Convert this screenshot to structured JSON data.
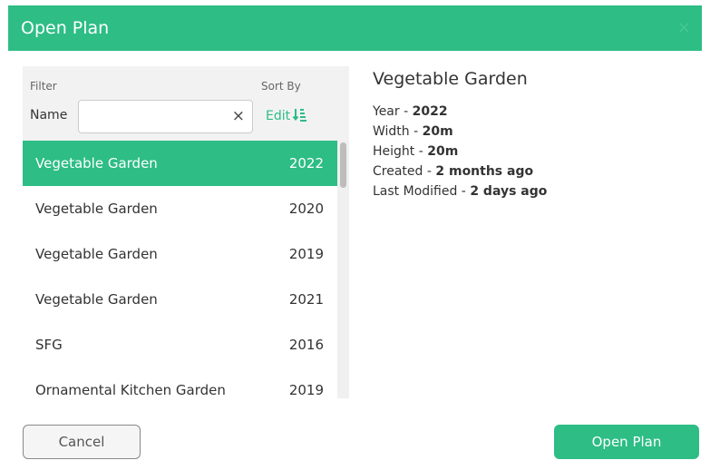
{
  "dialog": {
    "title": "Open Plan",
    "close_label": "×"
  },
  "filter": {
    "filter_label": "Filter",
    "name_label": "Name",
    "name_value": "",
    "clear_label": "×",
    "sort_by_label": "Sort By",
    "edit_label": "Edit"
  },
  "list": {
    "items": [
      {
        "name": "Vegetable Garden",
        "year": "2022",
        "selected": true
      },
      {
        "name": "Vegetable Garden",
        "year": "2020",
        "selected": false
      },
      {
        "name": "Vegetable Garden",
        "year": "2019",
        "selected": false
      },
      {
        "name": "Vegetable Garden",
        "year": "2021",
        "selected": false
      },
      {
        "name": "SFG",
        "year": "2016",
        "selected": false
      },
      {
        "name": "Ornamental Kitchen Garden",
        "year": "2019",
        "selected": false
      }
    ]
  },
  "details": {
    "title": "Vegetable Garden",
    "year_label": "Year - ",
    "year_value": "2022",
    "width_label": "Width - ",
    "width_value": "20m",
    "height_label": "Height - ",
    "height_value": "20m",
    "created_label": "Created - ",
    "created_value": "2 months ago",
    "modified_label": "Last Modified - ",
    "modified_value": "2 days ago"
  },
  "footer": {
    "cancel_label": "Cancel",
    "open_label": "Open Plan"
  },
  "colors": {
    "accent": "#2dbd85"
  },
  "icons": {
    "close": "close-icon",
    "clear": "clear-icon",
    "sort": "sort-icon"
  }
}
